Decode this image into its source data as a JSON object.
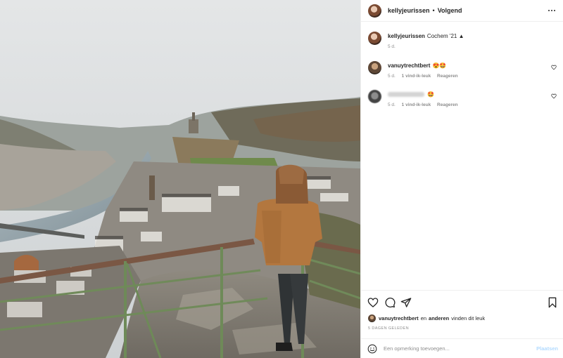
{
  "post": {
    "author": "kellyjeurissen",
    "follow_separator": "•",
    "follow_label": "Volgend",
    "more_icon": "more-options-icon"
  },
  "caption": {
    "username": "kellyjeurissen",
    "text": "Cochem '21 ▲",
    "time": "5 d."
  },
  "comments": [
    {
      "username": "vanuytrechtbert",
      "text": "😍🤩",
      "time": "5 d.",
      "likes": "1 vind-ik-leuk",
      "reply": "Reageren"
    },
    {
      "username": "",
      "text": "🤩",
      "time": "5 d.",
      "likes": "1 vind-ik-leuk",
      "reply": "Reageren"
    }
  ],
  "likes_line": {
    "username": "vanuytrechtbert",
    "connector": "en",
    "others": "anderen",
    "suffix": "vinden dit leuk"
  },
  "date": "5 DAGEN GELEDEN",
  "add_comment": {
    "placeholder": "Een opmerking toevoegen...",
    "post_label": "Plaatsen"
  },
  "colors": {
    "text": "#262626",
    "muted": "#8e8e8e",
    "border": "#efefef",
    "post_button_disabled": "#b3dbff",
    "jacket": "#b3773f"
  },
  "icons": [
    "heart-icon",
    "comment-icon",
    "share-icon",
    "bookmark-icon",
    "emoji-icon",
    "more-options-icon"
  ]
}
